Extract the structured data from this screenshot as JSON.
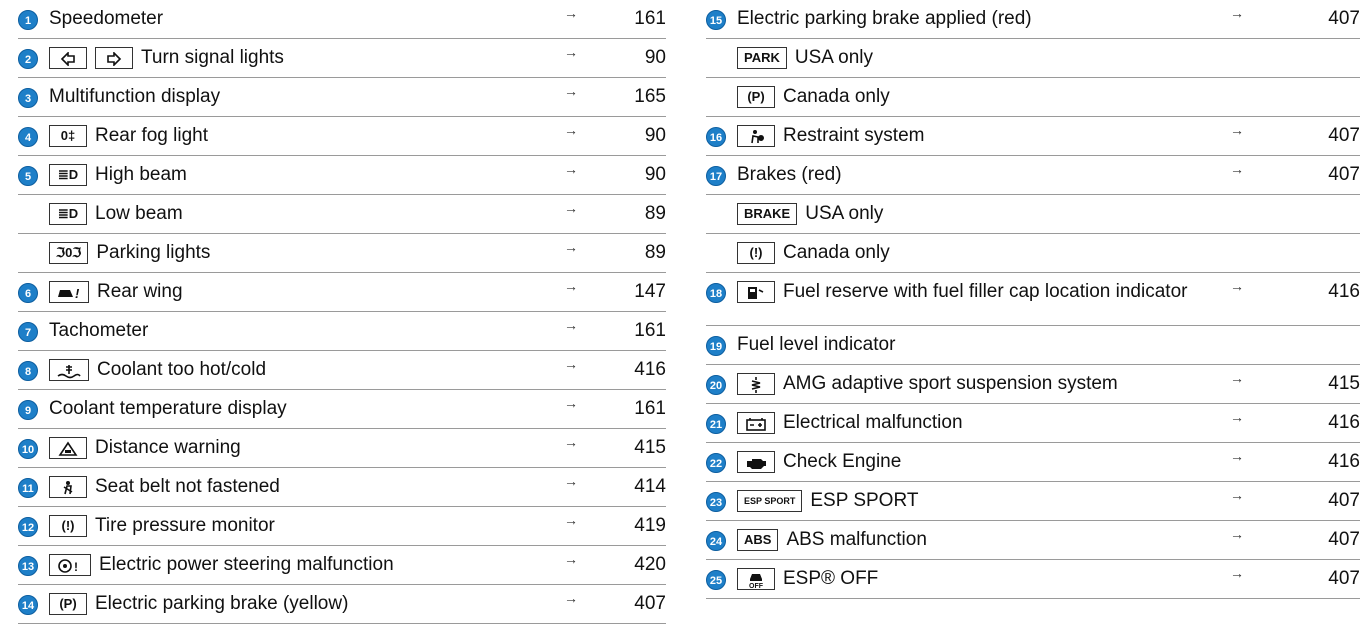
{
  "left": [
    {
      "num": "1",
      "label": "Speedometer",
      "page": "161",
      "arrow": "→",
      "symbols": []
    },
    {
      "num": "2",
      "label": "Turn signal lights",
      "page": "90",
      "arrow": "→",
      "symbols": [
        "turn-left",
        "turn-right"
      ]
    },
    {
      "num": "3",
      "label": "Multifunction display",
      "page": "165",
      "arrow": "→",
      "symbols": []
    },
    {
      "num": "4",
      "label": "Rear fog light",
      "page": "90",
      "arrow": "→",
      "symbols": [
        "0‡"
      ]
    },
    {
      "num": "5",
      "label": "High beam",
      "page": "90",
      "arrow": "→",
      "symbols": [
        "≣D"
      ]
    },
    {
      "num": "",
      "label": "Low beam",
      "page": "89",
      "arrow": "→",
      "symbols": [
        "≣D"
      ]
    },
    {
      "num": "",
      "label": "Parking lights",
      "page": "89",
      "arrow": "→",
      "symbols": [
        "ℑ0ℑ"
      ]
    },
    {
      "num": "6",
      "label": "Rear wing",
      "page": "147",
      "arrow": "→",
      "symbols": [
        "car!"
      ]
    },
    {
      "num": "7",
      "label": "Tachometer",
      "page": "161",
      "arrow": "→",
      "symbols": []
    },
    {
      "num": "8",
      "label": "Coolant too hot/cold",
      "page": "416",
      "arrow": "→",
      "symbols": [
        "coolant"
      ]
    },
    {
      "num": "9",
      "label": "Coolant temperature display",
      "page": "161",
      "arrow": "→",
      "symbols": []
    },
    {
      "num": "10",
      "label": "Distance warning",
      "page": "415",
      "arrow": "→",
      "symbols": [
        "dist"
      ]
    },
    {
      "num": "11",
      "label": "Seat belt not fastened",
      "page": "414",
      "arrow": "→",
      "symbols": [
        "belt"
      ]
    },
    {
      "num": "12",
      "label": "Tire pressure monitor",
      "page": "419",
      "arrow": "→",
      "symbols": [
        "(!)"
      ]
    },
    {
      "num": "13",
      "label": "Electric power steering malfunction",
      "page": "420",
      "arrow": "→",
      "symbols": [
        "wheel!"
      ]
    },
    {
      "num": "14",
      "label": "Electric parking brake (yellow)",
      "page": "407",
      "arrow": "→",
      "symbols": [
        "(P)"
      ]
    }
  ],
  "right": [
    {
      "num": "15",
      "label": "Electric parking brake applied (red)",
      "page": "407",
      "arrow": "→",
      "symbols": []
    },
    {
      "num": "",
      "label": "USA only",
      "page": "",
      "arrow": "",
      "symbols": [
        "PARK"
      ]
    },
    {
      "num": "",
      "label": "Canada only",
      "page": "",
      "arrow": "",
      "symbols": [
        "(P)"
      ]
    },
    {
      "num": "16",
      "label": "Restraint system",
      "page": "407",
      "arrow": "→",
      "symbols": [
        "airbag"
      ]
    },
    {
      "num": "17",
      "label": "Brakes (red)",
      "page": "407",
      "arrow": "→",
      "symbols": []
    },
    {
      "num": "",
      "label": "USA only",
      "page": "",
      "arrow": "",
      "symbols": [
        "BRAKE"
      ]
    },
    {
      "num": "",
      "label": "Canada only",
      "page": "",
      "arrow": "",
      "symbols": [
        "(!)"
      ]
    },
    {
      "num": "18",
      "label": "Fuel reserve with fuel filler cap location indicator",
      "page": "416",
      "arrow": "→",
      "symbols": [
        "fuel"
      ],
      "tall": true
    },
    {
      "num": "19",
      "label": "Fuel level indicator",
      "page": "",
      "arrow": "",
      "symbols": []
    },
    {
      "num": "20",
      "label": "AMG adaptive sport suspension system",
      "page": "415",
      "arrow": "→",
      "symbols": [
        "susp"
      ]
    },
    {
      "num": "21",
      "label": "Electrical malfunction",
      "page": "416",
      "arrow": "→",
      "symbols": [
        "batt"
      ]
    },
    {
      "num": "22",
      "label": "Check Engine",
      "page": "416",
      "arrow": "→",
      "symbols": [
        "engine"
      ]
    },
    {
      "num": "23",
      "label": "ESP SPORT",
      "page": "407",
      "arrow": "→",
      "symbols": [
        "ESP SPORT"
      ]
    },
    {
      "num": "24",
      "label": "ABS malfunction",
      "page": "407",
      "arrow": "→",
      "symbols": [
        "ABS"
      ]
    },
    {
      "num": "25",
      "label": "ESP® OFF",
      "page": "407",
      "arrow": "→",
      "symbols": [
        "espoff"
      ]
    }
  ],
  "colors": {
    "badge": "#1e7fc8",
    "rule": "#9a9a9a"
  }
}
